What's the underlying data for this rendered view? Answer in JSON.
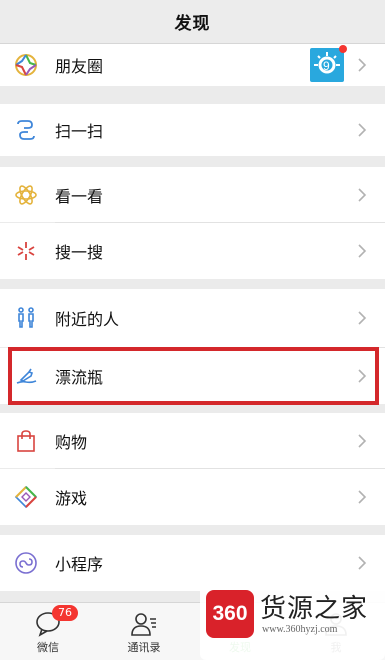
{
  "header": {
    "title": "发现"
  },
  "menu": [
    {
      "label": "朋友圈",
      "icon": "moments-icon"
    },
    {
      "label": "扫一扫",
      "icon": "scan-icon"
    },
    {
      "label": "看一看",
      "icon": "top-stories-icon"
    },
    {
      "label": "搜一搜",
      "icon": "search-icon"
    },
    {
      "label": "附近的人",
      "icon": "people-nearby-icon"
    },
    {
      "label": "漂流瓶",
      "icon": "drift-bottle-icon"
    },
    {
      "label": "购物",
      "icon": "shopping-bag-icon"
    },
    {
      "label": "游戏",
      "icon": "games-icon"
    },
    {
      "label": "小程序",
      "icon": "mini-programs-icon"
    }
  ],
  "tabbar": {
    "tabs": [
      {
        "label": "微信",
        "icon": "chat-bubble-icon",
        "badge": "76"
      },
      {
        "label": "通讯录",
        "icon": "contacts-icon"
      },
      {
        "label": "发现",
        "icon": "compass-icon",
        "active": true
      },
      {
        "label": "我",
        "icon": "me-icon"
      }
    ]
  },
  "watermark": {
    "logo": "360",
    "name": "货源之家",
    "url": "www.360hyzj.com"
  },
  "colors": {
    "accent": "#1aad19",
    "highlight": "#d4282b",
    "badge": "#f43530"
  }
}
